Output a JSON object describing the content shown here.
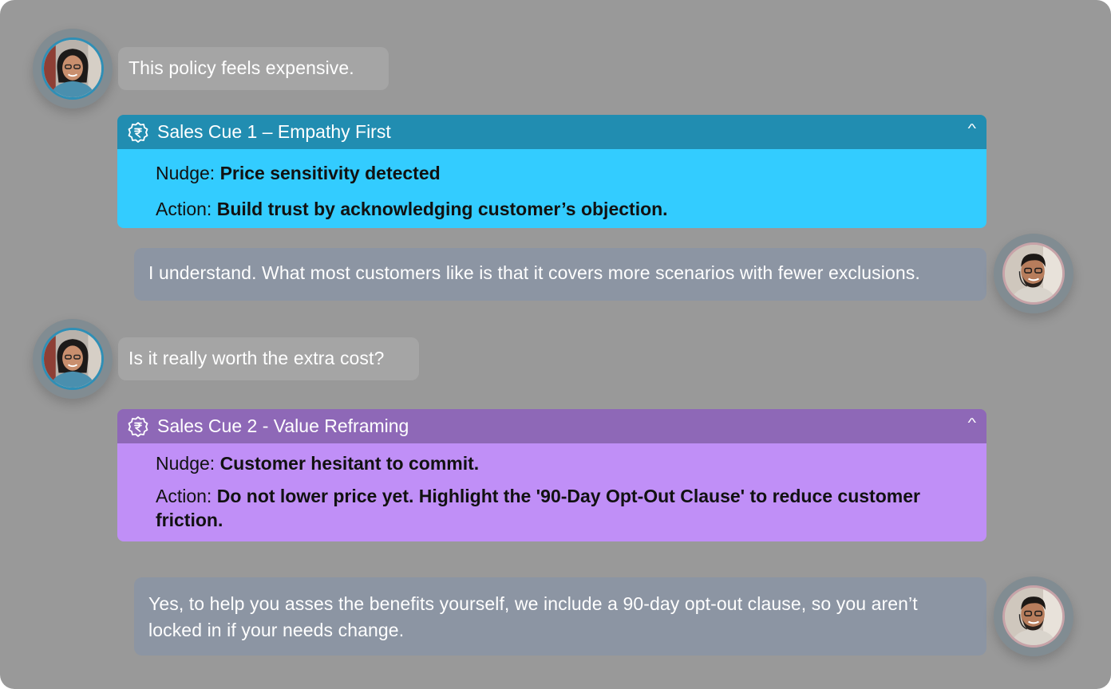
{
  "conversation": {
    "messages": [
      {
        "role": "customer",
        "text": "This policy feels expensive."
      },
      {
        "role": "agent",
        "text": "I understand. What most customers like is that it covers more scenarios with fewer exclusions."
      },
      {
        "role": "customer",
        "text": "Is it really worth the extra cost?"
      },
      {
        "role": "agent",
        "text": "Yes, to help you asses the benefits yourself, we include a 90-day opt-out clause, so you aren’t locked in if your needs change."
      }
    ]
  },
  "cues": [
    {
      "title": "Sales Cue 1 – Empathy First",
      "nudge_label": "Nudge:",
      "nudge": "Price sensitivity detected",
      "action_label": "Action:",
      "action": "Build trust by acknowledging customer’s objection.",
      "icon": "rupee-badge-icon",
      "collapse_icon": "chevron-up-icon",
      "header_color": "#218db1",
      "body_color": "#33ccff"
    },
    {
      "title": "Sales Cue 2 - Value Reframing",
      "nudge_label": "Nudge:",
      "nudge": "Customer hesitant to commit.",
      "action_label": "Action:",
      "action": "Do not lower price yet. Highlight the '90-Day Opt-Out Clause' to reduce customer friction.",
      "icon": "rupee-badge-icon",
      "collapse_icon": "chevron-up-icon",
      "header_color": "#8e68b7",
      "body_color": "#c08ff7"
    }
  ],
  "avatars": {
    "customer": "customer-avatar",
    "agent": "agent-avatar"
  },
  "colors": {
    "background": "#999999",
    "customer_bubble": "#a5a5a5",
    "agent_bubble": "#8c95a3"
  }
}
